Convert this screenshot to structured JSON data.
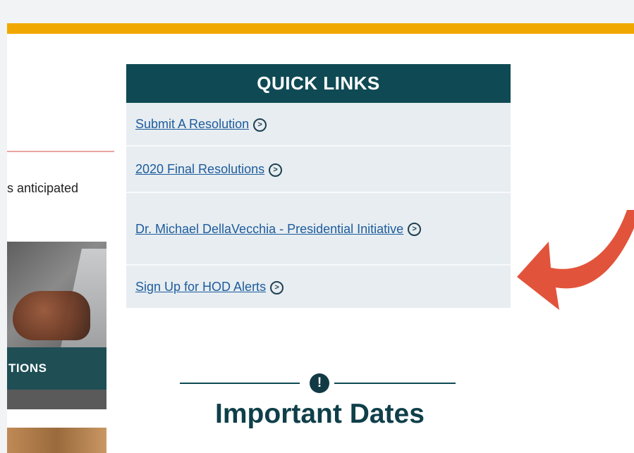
{
  "page": {
    "snippet_text": "s anticipated",
    "thumbnail_caption": "TIONS"
  },
  "quick_links": {
    "title": "QUICK LINKS",
    "items": [
      {
        "label": "Submit A Resolution"
      },
      {
        "label": "2020 Final Resolutions"
      },
      {
        "label": "Dr. Michael DellaVecchia - Presidential Initiative"
      },
      {
        "label": "Sign Up for HOD Alerts"
      }
    ],
    "link_icon": "circle-chevron-right-icon"
  },
  "important_dates": {
    "title": "Important Dates",
    "icon": "exclamation-circle-icon",
    "icon_glyph": "!"
  },
  "colors": {
    "header_bar": "#0f4a54",
    "accent_gold": "#f0a800",
    "link_blue": "#1e5c9e",
    "list_bg": "#e7edf0",
    "arrow_red": "#e2533b"
  }
}
